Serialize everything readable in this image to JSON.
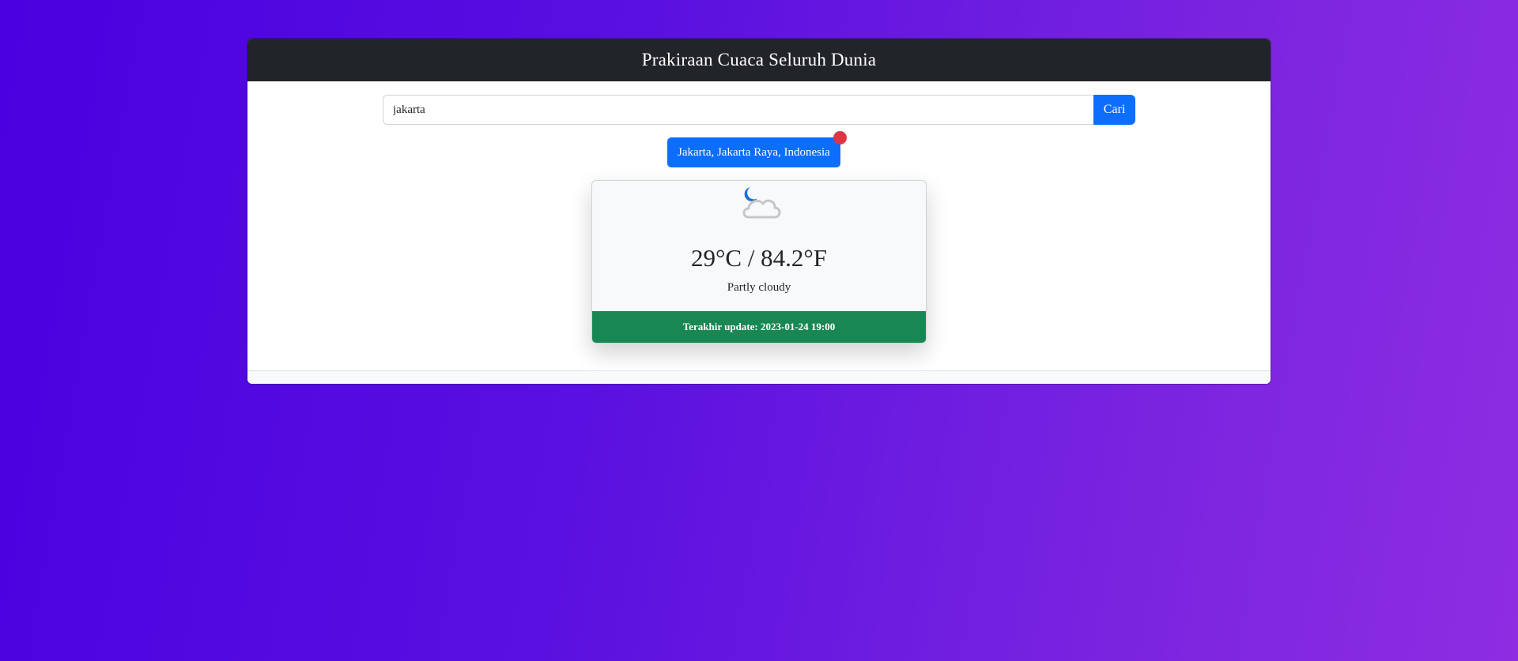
{
  "header": {
    "title": "Prakiraan Cuaca Seluruh Dunia"
  },
  "search": {
    "value": "jakarta",
    "button_label": "Cari"
  },
  "location": {
    "label": "Jakarta, Jakarta Raya, Indonesia"
  },
  "weather": {
    "icon": "partly-cloudy-night-icon",
    "temperature": "29°C / 84.2°F",
    "condition": "Partly cloudy",
    "last_update": "Terakhir update: 2023-01-24 19:00"
  },
  "colors": {
    "header_bg": "#212529",
    "primary": "#0d6efd",
    "badge": "#dc3545",
    "footer_green": "#198754",
    "gradient_start": "#4a00e0",
    "gradient_end": "#8e2de2"
  }
}
